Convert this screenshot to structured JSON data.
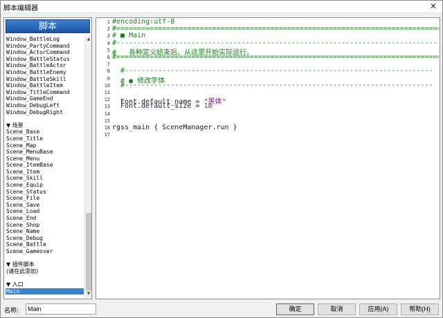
{
  "window": {
    "title": "脚本编辑器",
    "close": "✕"
  },
  "sidebar": {
    "header": "脚本",
    "items": [
      {
        "label": "Window_BattleLog",
        "type": "item"
      },
      {
        "label": "Window_PartyCommand",
        "type": "item"
      },
      {
        "label": "Window_ActorCommand",
        "type": "item"
      },
      {
        "label": "Window_BattleStatus",
        "type": "item"
      },
      {
        "label": "Window_BattleActor",
        "type": "item"
      },
      {
        "label": "Window_BattleEnemy",
        "type": "item"
      },
      {
        "label": "Window_BattleSkill",
        "type": "item"
      },
      {
        "label": "Window_BattleItem",
        "type": "item"
      },
      {
        "label": "Window_TitleCommand",
        "type": "item"
      },
      {
        "label": "Window_GameEnd",
        "type": "item"
      },
      {
        "label": "Window_DebugLeft",
        "type": "item"
      },
      {
        "label": "Window_DebugRight",
        "type": "item"
      },
      {
        "label": "",
        "type": "blank"
      },
      {
        "label": "▼ 场景",
        "type": "section"
      },
      {
        "label": "Scene_Base",
        "type": "item"
      },
      {
        "label": "Scene_Title",
        "type": "item"
      },
      {
        "label": "Scene_Map",
        "type": "item"
      },
      {
        "label": "Scene_MenuBase",
        "type": "item"
      },
      {
        "label": "Scene_Menu",
        "type": "item"
      },
      {
        "label": "Scene_ItemBase",
        "type": "item"
      },
      {
        "label": "Scene_Item",
        "type": "item"
      },
      {
        "label": "Scene_Skill",
        "type": "item"
      },
      {
        "label": "Scene_Equip",
        "type": "item"
      },
      {
        "label": "Scene_Status",
        "type": "item"
      },
      {
        "label": "Scene_File",
        "type": "item"
      },
      {
        "label": "Scene_Save",
        "type": "item"
      },
      {
        "label": "Scene_Load",
        "type": "item"
      },
      {
        "label": "Scene_End",
        "type": "item"
      },
      {
        "label": "Scene_Shop",
        "type": "item"
      },
      {
        "label": "Scene_Name",
        "type": "item"
      },
      {
        "label": "Scene_Debug",
        "type": "item"
      },
      {
        "label": "Scene_Battle",
        "type": "item"
      },
      {
        "label": "Scene_Gameover",
        "type": "item"
      },
      {
        "label": "",
        "type": "blank"
      },
      {
        "label": "▼ 插件脚本",
        "type": "section"
      },
      {
        "label": "(请在此添加)",
        "type": "section"
      },
      {
        "label": "",
        "type": "blank"
      },
      {
        "label": "▼ 入口",
        "type": "section"
      },
      {
        "label": "Main",
        "type": "selected"
      }
    ]
  },
  "editor": {
    "lines": [
      {
        "n": "1",
        "segs": [
          {
            "t": "#encoding:utf-8",
            "c": "green"
          }
        ]
      },
      {
        "n": "2",
        "segs": [
          {
            "t": "#==============================================================================",
            "c": "green"
          }
        ]
      },
      {
        "n": "3",
        "segs": [
          {
            "t": "# ■ Main",
            "c": "green"
          }
        ]
      },
      {
        "n": "4",
        "segs": [
          {
            "t": "#------------------------------------------------------------------------------",
            "c": "green"
          }
        ]
      },
      {
        "n": "5",
        "segs": [
          {
            "t": "#   各种定义结束后，从这里开始实际运行。",
            "c": "green"
          }
        ]
      },
      {
        "n": "6",
        "segs": [
          {
            "t": "#==============================================================================",
            "c": "green"
          }
        ]
      },
      {
        "n": "7",
        "segs": []
      },
      {
        "n": "8",
        "segs": [
          {
            "t": "  #--------------------------------------------------------------------------",
            "c": "green"
          }
        ]
      },
      {
        "n": "9",
        "segs": [
          {
            "t": "  # ● 修改字体",
            "c": "green"
          }
        ]
      },
      {
        "n": "10",
        "segs": [
          {
            "t": "  #--------------------------------------------------------------------------",
            "c": "green"
          }
        ]
      },
      {
        "n": "11",
        "segs": []
      },
      {
        "n": "12",
        "segs": [
          {
            "t": "  Font.default_name = ",
            "c": "dark"
          },
          {
            "t": "\"黑体\"",
            "c": "purple"
          }
        ]
      },
      {
        "n": "13",
        "segs": [
          {
            "t": "  Font.default_size = ",
            "c": "dark"
          },
          {
            "t": "18",
            "c": "purple"
          }
        ]
      },
      {
        "n": "14",
        "segs": []
      },
      {
        "n": "15",
        "segs": []
      },
      {
        "n": "16",
        "segs": [
          {
            "t": "rgss_main { SceneManager.run }",
            "c": "dark"
          }
        ]
      },
      {
        "n": "17",
        "segs": []
      }
    ]
  },
  "footer": {
    "name_label": "名称:",
    "name_value": "Main",
    "ok": "确定",
    "cancel": "取消",
    "apply": "应用(A)",
    "help": "帮助(H)"
  },
  "colors": {
    "accent": "#1b55a8",
    "selection": "#3a83d1",
    "comment": "#0b8a0b",
    "literal": "#8a1a8a"
  }
}
